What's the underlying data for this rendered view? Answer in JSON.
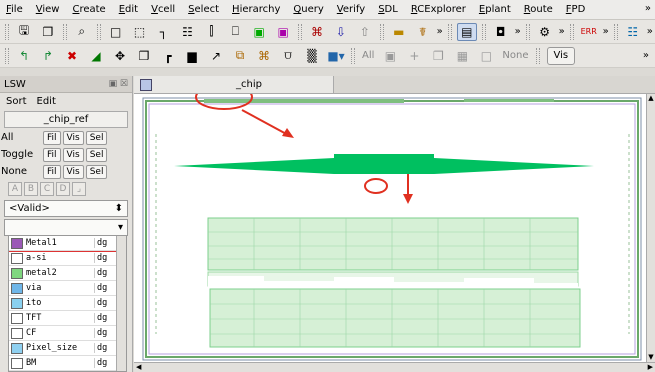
{
  "menubar": {
    "items": [
      {
        "label": "File",
        "u": "F"
      },
      {
        "label": "View",
        "u": "V"
      },
      {
        "label": "Create",
        "u": "C"
      },
      {
        "label": "Edit",
        "u": "E"
      },
      {
        "label": "Vcell",
        "u": "V"
      },
      {
        "label": "Select",
        "u": "S"
      },
      {
        "label": "Hierarchy",
        "u": "H"
      },
      {
        "label": "Query",
        "u": "Q"
      },
      {
        "label": "Verify",
        "u": "V"
      },
      {
        "label": "SDL",
        "u": "S"
      },
      {
        "label": "RCExplorer",
        "u": "R"
      },
      {
        "label": "Eplant",
        "u": "E"
      },
      {
        "label": "Route",
        "u": "R"
      },
      {
        "label": "FPD",
        "u": "F"
      }
    ],
    "overflow": "»"
  },
  "toolbar2": {
    "all_label": "All",
    "none_label": "None",
    "vis_label": "Vis"
  },
  "lsw": {
    "title": "LSW",
    "menu": [
      "Sort",
      "Edit"
    ],
    "cell_name": "_chip_ref",
    "rows": [
      {
        "label": "All",
        "buttons": [
          "Fil",
          "Vis",
          "Sel"
        ]
      },
      {
        "label": "Toggle",
        "buttons": [
          "Fil",
          "Vis",
          "Sel"
        ]
      },
      {
        "label": "None",
        "buttons": [
          "Fil",
          "Vis",
          "Sel"
        ]
      }
    ],
    "letters": [
      "A",
      "B",
      "C",
      "D"
    ],
    "filter": "<Valid>",
    "filter2": "",
    "layers": [
      {
        "name": "Metal1",
        "purpose": "dg",
        "color": "#9b59b6",
        "selected": true
      },
      {
        "name": "a-si",
        "purpose": "dg",
        "color": "#ffffff"
      },
      {
        "name": "metal2",
        "purpose": "dg",
        "color": "#7fd67f"
      },
      {
        "name": "via",
        "purpose": "dg",
        "color": "#6fb6e8"
      },
      {
        "name": "ito",
        "purpose": "dg",
        "color": "#8ad1f0"
      },
      {
        "name": "TFT",
        "purpose": "dg",
        "color": "#ffffff"
      },
      {
        "name": "CF",
        "purpose": "dg",
        "color": "#ffffff"
      },
      {
        "name": "Pixel_size",
        "purpose": "dg",
        "color": "#8fd0f0"
      },
      {
        "name": "BM",
        "purpose": "dg",
        "color": "#ffffff"
      }
    ]
  },
  "canvas": {
    "tab_title": "_chip",
    "accent": "#00c060",
    "annotation_color": "#e03020"
  }
}
